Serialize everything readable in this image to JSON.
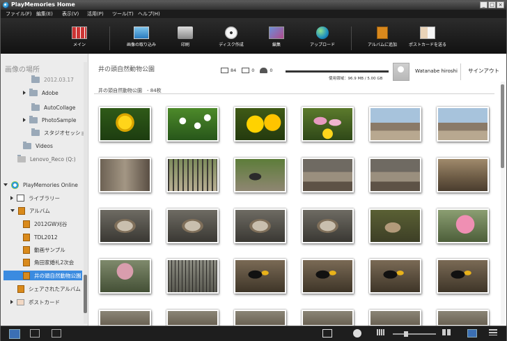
{
  "window": {
    "title": "PlayMemories Home",
    "buttons": [
      "_",
      "□",
      "×"
    ]
  },
  "menu": [
    "ファイル(F)",
    "編集(E)",
    "表示(V)",
    "活用(P)",
    "ツール(T)",
    "ヘルプ(H)"
  ],
  "toolbar": [
    {
      "label": "メイン",
      "icon": "grid-icon"
    },
    {
      "label": "画像の取り込み",
      "icon": "import-icon"
    },
    {
      "label": "印刷",
      "icon": "printer-icon"
    },
    {
      "label": "ディスク作成",
      "icon": "disc-icon"
    },
    {
      "label": "編集",
      "icon": "edit-icon"
    },
    {
      "label": "アップロード",
      "icon": "globe-icon"
    },
    {
      "label": "アルバムに追加",
      "icon": "album-add-icon"
    },
    {
      "label": "ポストカードを送る",
      "icon": "postcard-icon"
    }
  ],
  "sidebar": {
    "header": "画像の場所",
    "items": [
      {
        "label": "2012.03.17",
        "type": "folder"
      },
      {
        "label": "Adobe",
        "type": "folder"
      },
      {
        "label": "AutoCollage",
        "type": "folder"
      },
      {
        "label": "PhotoSample",
        "type": "folder"
      },
      {
        "label": "スタジオセッショ",
        "type": "folder"
      },
      {
        "label": "Videos",
        "type": "folder"
      },
      {
        "label": "Lenovo_Reco (Q:)",
        "type": "drive"
      },
      {
        "label": "PlayMemories Online",
        "type": "online"
      },
      {
        "label": "ライブラリー",
        "type": "library"
      },
      {
        "label": "アルバム",
        "type": "album"
      },
      {
        "label": "2012GW刈谷",
        "type": "album"
      },
      {
        "label": "TDL2012",
        "type": "album"
      },
      {
        "label": "動画サンプル",
        "type": "album"
      },
      {
        "label": "角田家婚礼2次会",
        "type": "album"
      },
      {
        "label": "井の頭自然動物公園",
        "type": "album",
        "selected": true
      },
      {
        "label": "シェアされたアルバム",
        "type": "album"
      },
      {
        "label": "ポストカード",
        "type": "postcard"
      }
    ]
  },
  "main": {
    "title": "井の頭自然動物公園",
    "stats": {
      "photos": "84",
      "videos": "0",
      "people": "0"
    },
    "storage": "使用領域：96.9 MB / 5.00 GB",
    "user": "Watanabe hiroshi",
    "signout": "サインアウト",
    "subheading": "井の頭自然動物公園　- 84枚",
    "photos": [
      "yellow-tulip",
      "white-daisies",
      "yellow-flowers",
      "pink-tulips",
      "zoo-building",
      "zoo-building",
      "goat-enclosure",
      "cage-yard",
      "goat-rock",
      "enclosure",
      "enclosure",
      "log-animal",
      "owl",
      "owl",
      "owl",
      "owl",
      "sleeping-animal",
      "pink-blossom",
      "blossom-tree",
      "cage",
      "toucan",
      "toucan",
      "toucan",
      "toucan",
      "row5",
      "row5",
      "row5",
      "row5",
      "row5",
      "row5"
    ]
  },
  "colors": {
    "selected": "#3b8be0",
    "toolbar_bg": "#1a1a1a"
  }
}
